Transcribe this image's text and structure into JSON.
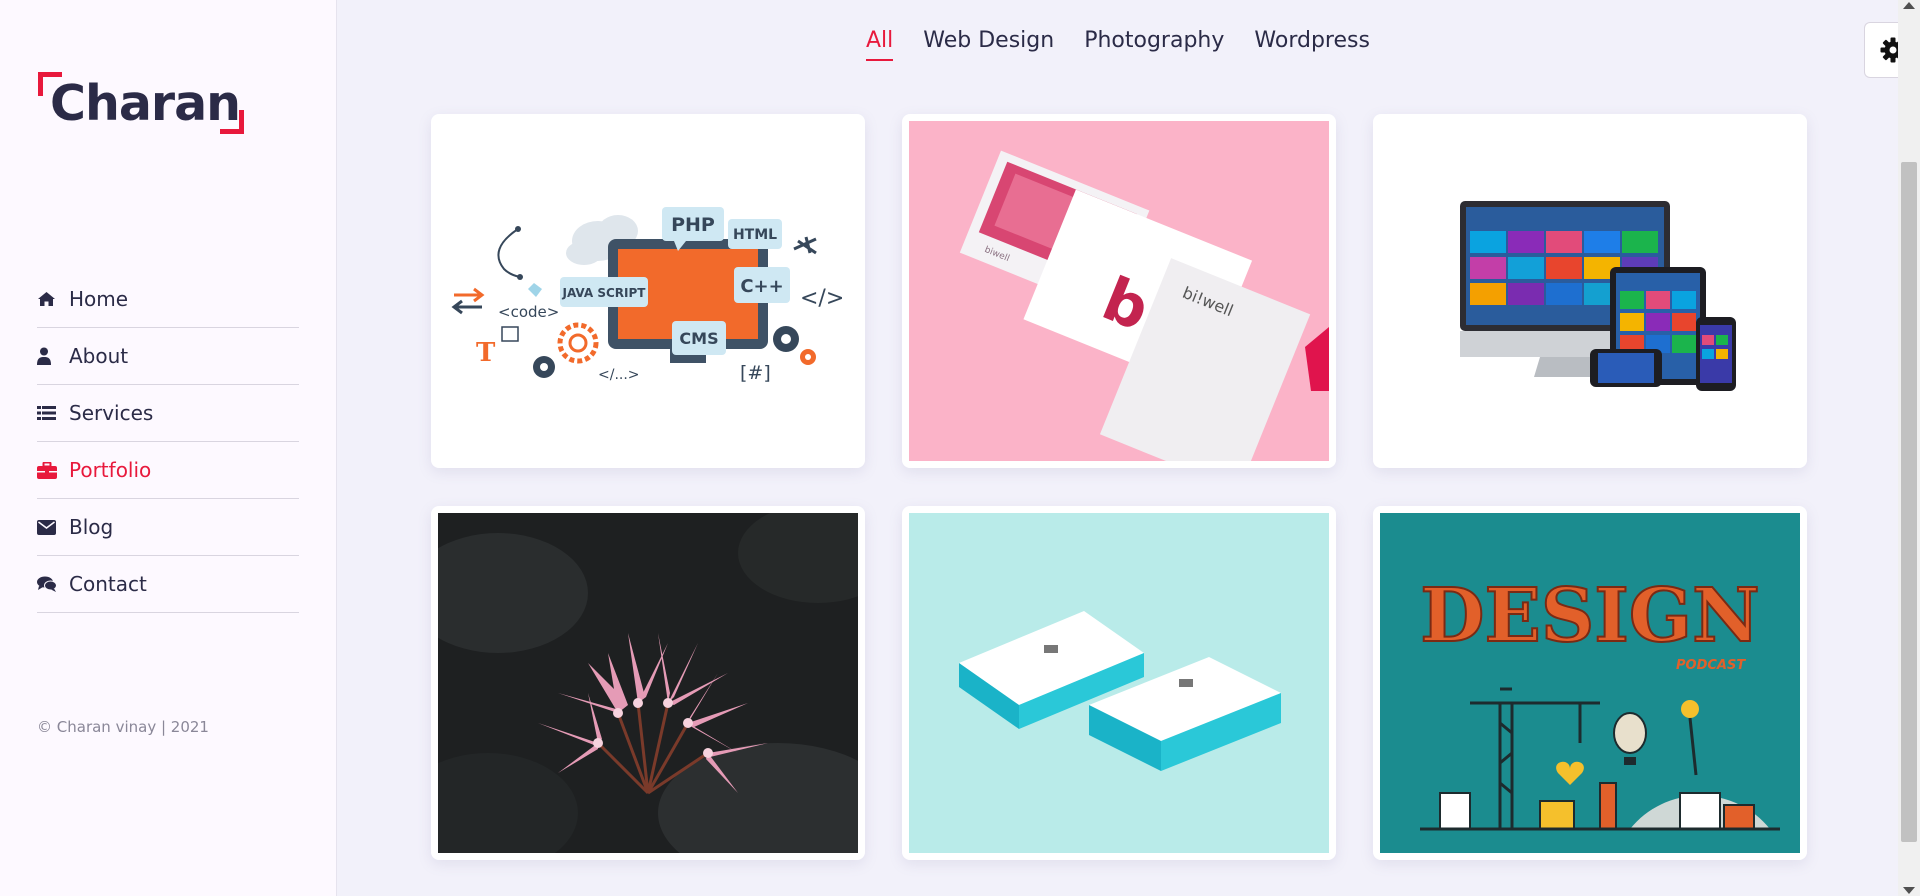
{
  "brand": {
    "logo_text": "Charan",
    "accent_color": "#e8193c",
    "text_color": "#2b2b47"
  },
  "sidebar": {
    "items": [
      {
        "label": "Home",
        "icon": "home-icon",
        "active": false
      },
      {
        "label": "About",
        "icon": "user-icon",
        "active": false
      },
      {
        "label": "Services",
        "icon": "list-icon",
        "active": false
      },
      {
        "label": "Portfolio",
        "icon": "briefcase-icon",
        "active": true
      },
      {
        "label": "Blog",
        "icon": "envelope-icon",
        "active": false
      },
      {
        "label": "Contact",
        "icon": "comments-icon",
        "active": false
      }
    ],
    "copyright": "© Charan vinay | 2021"
  },
  "portfolio": {
    "filters": [
      {
        "label": "All",
        "active": true
      },
      {
        "label": "Web Design",
        "active": false
      },
      {
        "label": "Photography",
        "active": false
      },
      {
        "label": "Wordpress",
        "active": false
      }
    ],
    "items": [
      {
        "name": "web-development-illustration",
        "tags": [
          "PHP",
          "HTML",
          "C++",
          "CMS",
          "JAVA SCRIPT",
          "<code>",
          "</>",
          "</...>",
          "[#]",
          "T"
        ]
      },
      {
        "name": "biwell-stationery-mockup",
        "tags": [
          "b!",
          "bi!well",
          "biwell"
        ]
      },
      {
        "name": "responsive-devices-mockup",
        "tags": []
      },
      {
        "name": "pink-flower-photo",
        "tags": []
      },
      {
        "name": "business-cards-mockup",
        "tags": []
      },
      {
        "name": "design-podcast-poster",
        "tags": [
          "DESIGN",
          "PODCAST"
        ]
      }
    ]
  },
  "settings": {
    "icon": "gear-icon"
  }
}
